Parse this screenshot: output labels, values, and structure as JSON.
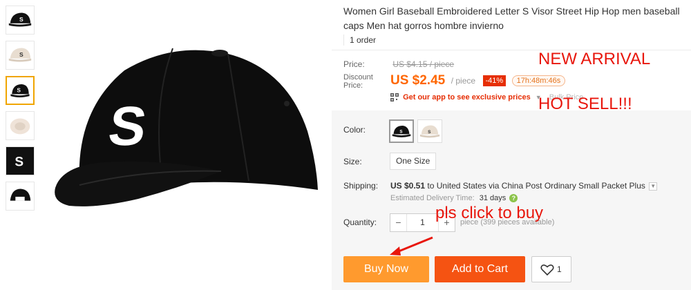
{
  "product": {
    "title": "Women Girl Baseball Embroidered Letter S Visor Street Hip Hop men baseball caps Men hat gorros hombre invierno",
    "orders": "1 order"
  },
  "price": {
    "label": "Price:",
    "original": "US $4.15 / piece",
    "discount_label": "Discount Price:",
    "current": "US $2.45",
    "unit": "/ piece",
    "off": "-41%",
    "timer": "17h:48m:46s",
    "app_promo": "Get our app to see exclusive prices",
    "bulk": "Bulk Price"
  },
  "options": {
    "color_label": "Color:",
    "colors": [
      "black-cap",
      "beige-cap"
    ],
    "size_label": "Size:",
    "size": "One Size"
  },
  "shipping": {
    "label": "Shipping:",
    "cost": "US $0.51",
    "to": "to United States via China Post Ordinary Small Packet Plus",
    "delivery_label": "Estimated Delivery Time:",
    "days": "31 days"
  },
  "quantity": {
    "label": "Quantity:",
    "value": "1",
    "minus": "−",
    "plus": "+",
    "available": "piece (399 pieces available)"
  },
  "actions": {
    "buy_now": "Buy Now",
    "add_to_cart": "Add to Cart",
    "wish_count": "1"
  },
  "annotations": {
    "new_arrival": "NEW ARRIVAL",
    "hot_sell": "HOT SELL!!!",
    "click_to_buy": "pls click to buy"
  },
  "colors": {
    "accent": "#ff9a2e",
    "cart": "#f55312",
    "price": "#ff6600",
    "annotation": "#e8160c"
  }
}
